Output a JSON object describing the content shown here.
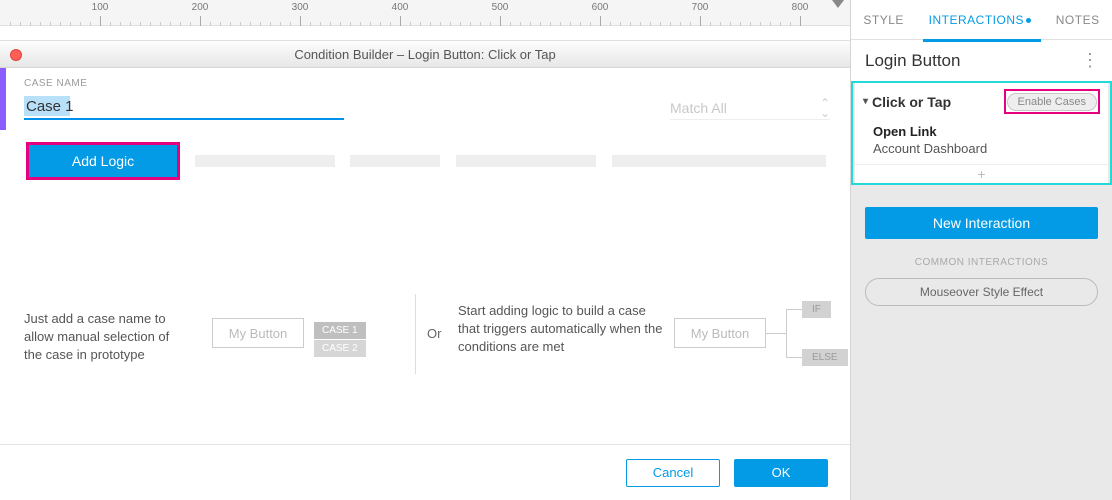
{
  "ruler": {
    "ticks": [
      100,
      200,
      300,
      400,
      500,
      600,
      700,
      800
    ]
  },
  "modal": {
    "title": "Condition Builder   –   Login Button: Click or Tap",
    "case_label": "CASE NAME",
    "case_value": "Case 1",
    "match_all": "Match All",
    "add_logic": "Add Logic",
    "help_left": "Just add a case name to allow manual selection of the case in prototype",
    "demo_btn": "My Button",
    "case1": "CASE 1",
    "case2": "CASE 2",
    "or": "Or",
    "help_right": "Start adding logic to build a case that triggers automatically when the conditions are met",
    "if": "IF",
    "else": "ELSE",
    "cancel": "Cancel",
    "ok": "OK"
  },
  "right": {
    "tabs": {
      "style": "STYLE",
      "interactions": "INTERACTIONS",
      "notes": "NOTES"
    },
    "title": "Login Button",
    "event": "Click or Tap",
    "enable": "Enable Cases",
    "action": "Open Link",
    "target": "Account Dashboard",
    "new_interaction": "New Interaction",
    "common_label": "COMMON INTERACTIONS",
    "mouseover": "Mouseover Style Effect"
  }
}
